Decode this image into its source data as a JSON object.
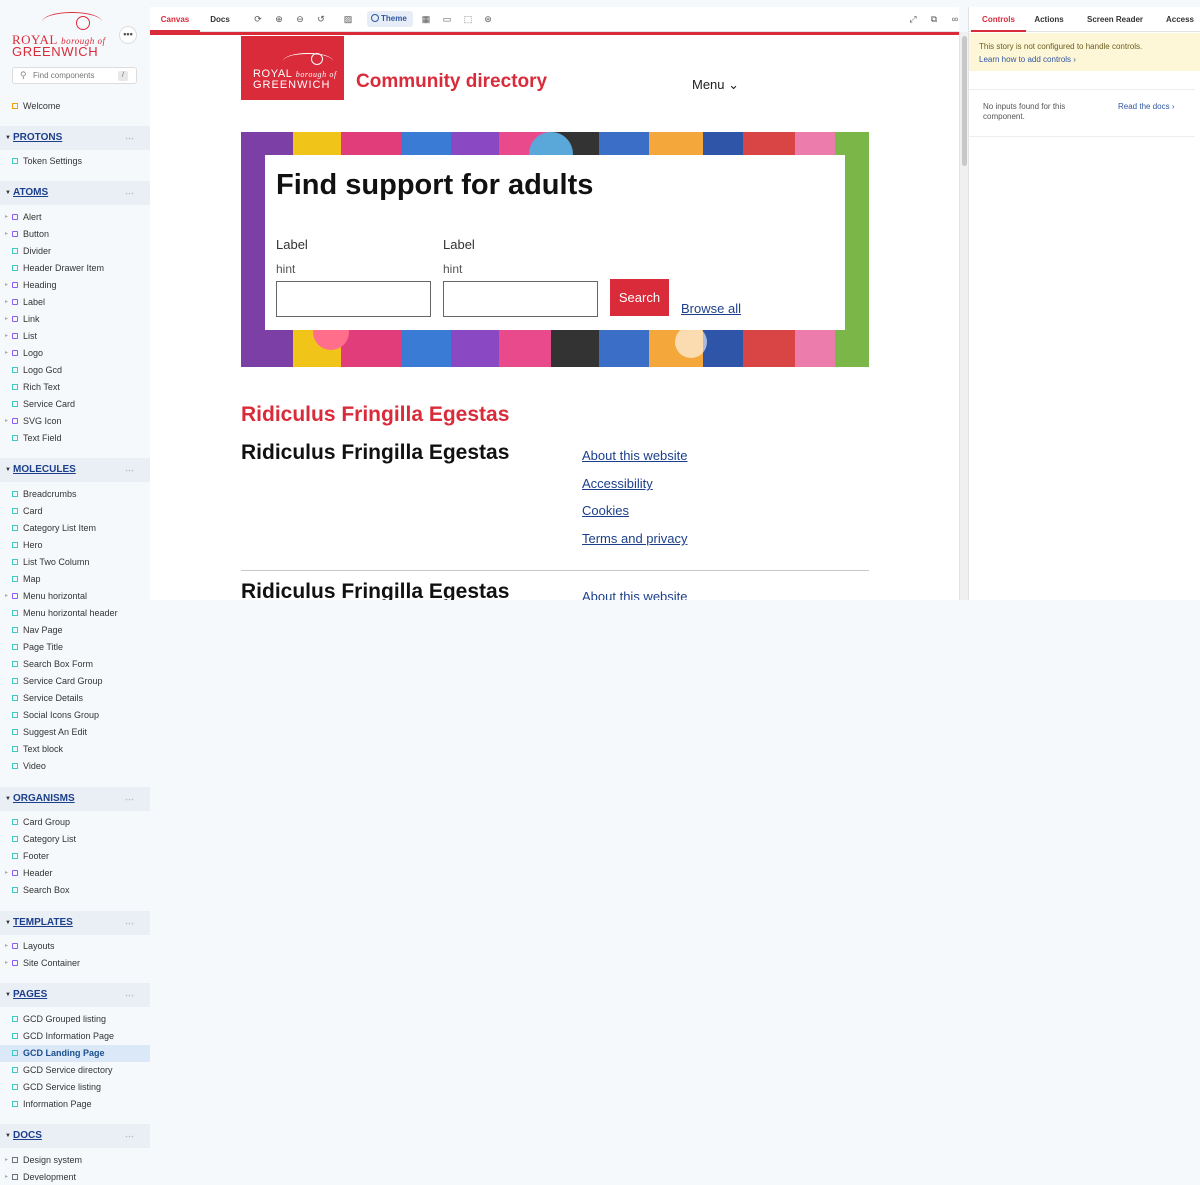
{
  "sidebar": {
    "logo": {
      "royal": "ROYAL",
      "borough": "borough of",
      "greenwich": "GREENWICH"
    },
    "more": "•••",
    "search": {
      "placeholder": "Find components",
      "shortcut": "/"
    },
    "welcome": "Welcome",
    "groups": {
      "protons": "PROTONS",
      "atoms": "ATOMS",
      "molecules": "MOLECULES",
      "organisms": "ORGANISMS",
      "templates": "TEMPLATES",
      "pages": "PAGES",
      "docs": "DOCS"
    },
    "protons": [
      "Token Settings"
    ],
    "atoms": [
      "Alert",
      "Button",
      "Divider",
      "Header Drawer Item",
      "Heading",
      "Label",
      "Link",
      "List",
      "Logo",
      "Logo Gcd",
      "Rich Text",
      "Service Card",
      "SVG Icon",
      "Text Field"
    ],
    "molecules": [
      "Breadcrumbs",
      "Card",
      "Category List Item",
      "Hero",
      "List Two Column",
      "Map",
      "Menu horizontal",
      "Menu horizontal header",
      "Nav Page",
      "Page Title",
      "Search Box Form",
      "Service Card Group",
      "Service Details",
      "Social Icons Group",
      "Suggest An Edit",
      "Text block",
      "Video"
    ],
    "organisms": [
      "Card Group",
      "Category List",
      "Footer",
      "Header",
      "Search Box"
    ],
    "templates": [
      "Layouts",
      "Site Container"
    ],
    "pages": [
      "GCD Grouped listing",
      "GCD Information Page",
      "GCD Landing Page",
      "GCD Service directory",
      "GCD Service listing",
      "Information Page"
    ],
    "docs": [
      "Design system",
      "Development"
    ]
  },
  "toolbar": {
    "tabs": {
      "canvas": "Canvas",
      "docs": "Docs"
    },
    "theme": "Theme",
    "icons": [
      "reload-icon",
      "zoom-in-icon",
      "zoom-out-icon",
      "zoom-reset-icon",
      "background-icon",
      "grid-icon",
      "viewport-icon",
      "measure-icon",
      "outline-icon",
      "accessibility-icon",
      "fullscreen-icon",
      "open-new-icon",
      "link-icon"
    ]
  },
  "addon": {
    "tabs": {
      "controls": "Controls",
      "actions": "Actions",
      "screen_reader": "Screen Reader",
      "access": "Access"
    },
    "note": "This story is not configured to handle controls.",
    "note_link": "Learn how to add controls ›",
    "empty": "No inputs found for this component.",
    "docs_link": "Read the docs ›"
  },
  "preview": {
    "logo": {
      "royal": "ROYAL",
      "borough": "borough of",
      "greenwich": "GREENWICH"
    },
    "site_title": "Community directory",
    "menu": "Menu",
    "hero_title": "Find support for adults",
    "field1": {
      "label": "Label",
      "hint": "hint"
    },
    "field2": {
      "label": "Label",
      "hint": "hint"
    },
    "search_button": "Search",
    "browse": "Browse all",
    "heading_red": "Ridiculus Fringilla Egestas",
    "heading_black": "Ridiculus Fringilla Egestas",
    "heading_black_2": "Ridiculus Fringilla Egestas",
    "footer_links": [
      "About this website",
      "Accessibility",
      "Cookies",
      "Terms and privacy"
    ],
    "footer_link_repeat": "About this website"
  },
  "colors": {
    "brand": "#d92b3a",
    "link": "#1c3f8b",
    "accent": "#3056a0"
  }
}
